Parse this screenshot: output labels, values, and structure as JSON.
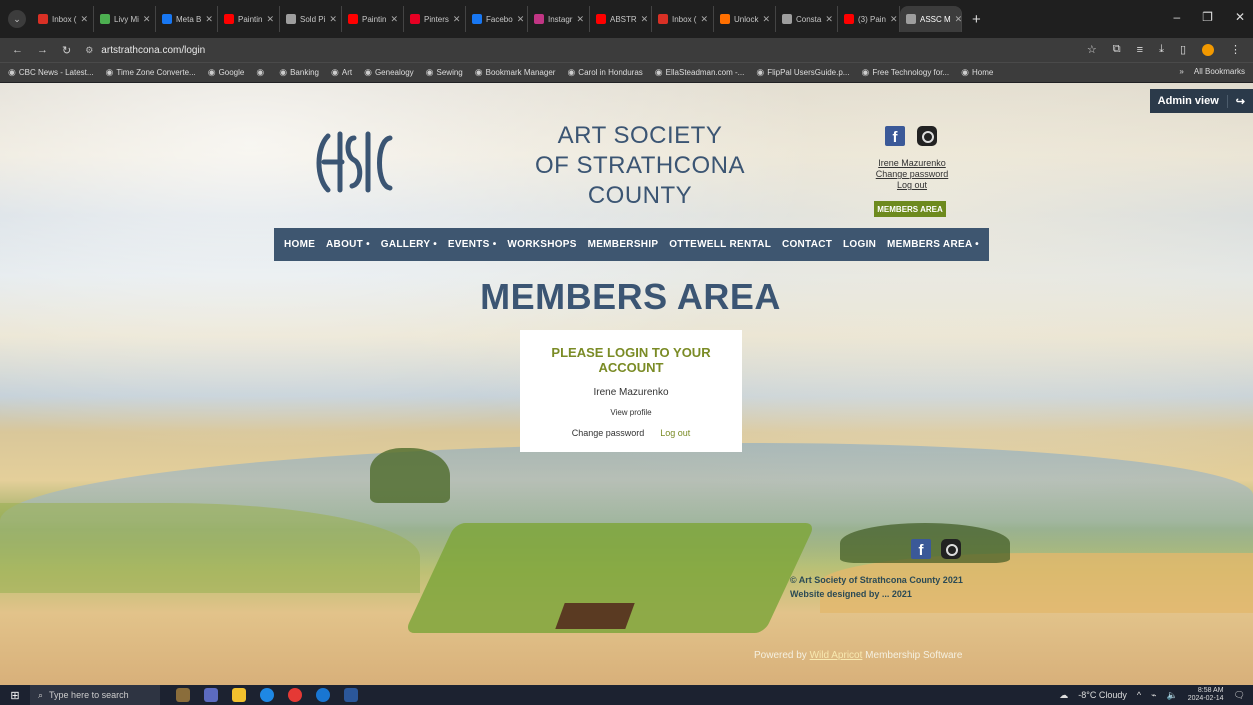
{
  "browser": {
    "tabs": [
      {
        "label": "Inbox (",
        "color": "#d93025"
      },
      {
        "label": "Livy Mi",
        "color": "#4caf50"
      },
      {
        "label": "Meta B",
        "color": "#1877f2"
      },
      {
        "label": "Paintin",
        "color": "#ff0000"
      },
      {
        "label": "Sold Pi",
        "color": "#9e9e9e"
      },
      {
        "label": "Paintin",
        "color": "#ff0000"
      },
      {
        "label": "Pinters",
        "color": "#e60023"
      },
      {
        "label": "Facebo",
        "color": "#1877f2"
      },
      {
        "label": "Instagr",
        "color": "#c13584"
      },
      {
        "label": "ABSTR",
        "color": "#ff0000"
      },
      {
        "label": "Inbox (",
        "color": "#d93025"
      },
      {
        "label": "Unlock",
        "color": "#ff6f00"
      },
      {
        "label": "Consta",
        "color": "#9e9e9e"
      },
      {
        "label": "(3) Pain",
        "color": "#ff0000"
      },
      {
        "label": "ASSC M",
        "color": "#9e9e9e",
        "active": true
      }
    ],
    "url": "artstrathcona.com/login",
    "bookmarks": [
      "CBC News - Latest...",
      "Time Zone Converte...",
      "Google",
      "",
      "Banking",
      "Art",
      "Genealogy",
      "Sewing",
      "Bookmark Manager",
      "Carol in Honduras",
      "EllaSteadman.com -...",
      "FlipPal UsersGuide.p...",
      "Free Technology for...",
      "Home"
    ],
    "all_bookmarks": "All Bookmarks"
  },
  "admin": {
    "label": "Admin view"
  },
  "site": {
    "title_line1": "ART SOCIETY",
    "title_line2": "OF STRATHCONA",
    "title_line3": "COUNTY",
    "user_name": "Irene Mazurenko",
    "change_password": "Change password",
    "log_out": "Log out",
    "members_area_button": "MEMBERS AREA"
  },
  "menu": [
    "HOME",
    "ABOUT •",
    "GALLERY •",
    "EVENTS •",
    "WORKSHOPS",
    "MEMBERSHIP",
    "OTTEWELL RENTAL",
    "CONTACT",
    "LOGIN",
    "MEMBERS AREA •"
  ],
  "main": {
    "heading": "MEMBERS AREA",
    "login_box": {
      "heading": "PLEASE LOGIN TO YOUR ACCOUNT",
      "name": "Irene Mazurenko",
      "view_profile": "View profile",
      "change_password": "Change password",
      "log_out": "Log out"
    }
  },
  "footer": {
    "copyright": "© Art Society of Strathcona County 2021",
    "designed_by": "Website designed by ... 2021",
    "powered_prefix": "Powered by",
    "powered_link": "Wild Apricot",
    "powered_suffix": "Membership Software"
  },
  "taskbar": {
    "search_placeholder": "Type here to search",
    "weather": "-8°C Cloudy",
    "time": "8:58 AM",
    "date": "2024-02-14"
  }
}
